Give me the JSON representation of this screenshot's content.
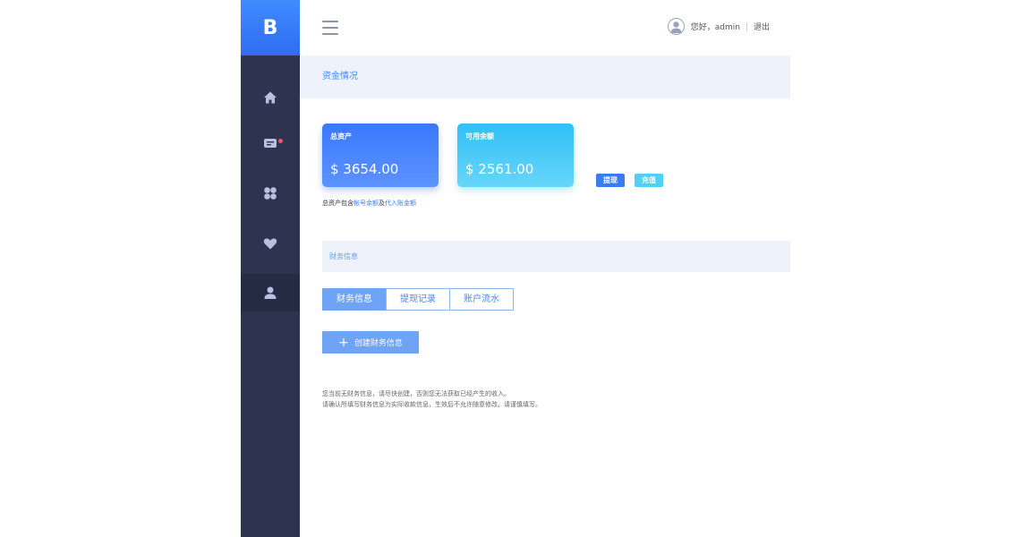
{
  "logo": {
    "letter": "B"
  },
  "sidebar": {
    "items": [
      {
        "name": "home",
        "active": false
      },
      {
        "name": "messages",
        "active": false,
        "badge": true
      },
      {
        "name": "apps",
        "active": false
      },
      {
        "name": "favorites",
        "active": false
      },
      {
        "name": "user",
        "active": true
      }
    ]
  },
  "header": {
    "greeting": "您好，admin",
    "logout": "退出"
  },
  "funds": {
    "section_title": "资金情况",
    "total_label": "总资产",
    "total_amount": "$ 3654.00",
    "available_label": "可用余额",
    "available_amount": "$ 2561.00",
    "withdraw_button": "提现",
    "recharge_button": "充值",
    "note_prefix": "总资产包含",
    "note_link1": "帐号余额",
    "note_mid": "及",
    "note_link2": "代入账金额"
  },
  "finance": {
    "section_title": "财务信息",
    "tabs": [
      "财务信息",
      "提现记录",
      "账户流水"
    ],
    "create_button": "创建财务信息",
    "hint_line1": "您当前无财务信息，请尽快创建，否则您无法获取已经产生的收入。",
    "hint_line2": "请确认所填写财务信息为实际收款信息，生效后不允许随意修改。请谨慎填写。"
  },
  "colors": {
    "sidebar": "#2e3450",
    "accent": "#3b7cf5",
    "cyan": "#4fd0f8"
  }
}
